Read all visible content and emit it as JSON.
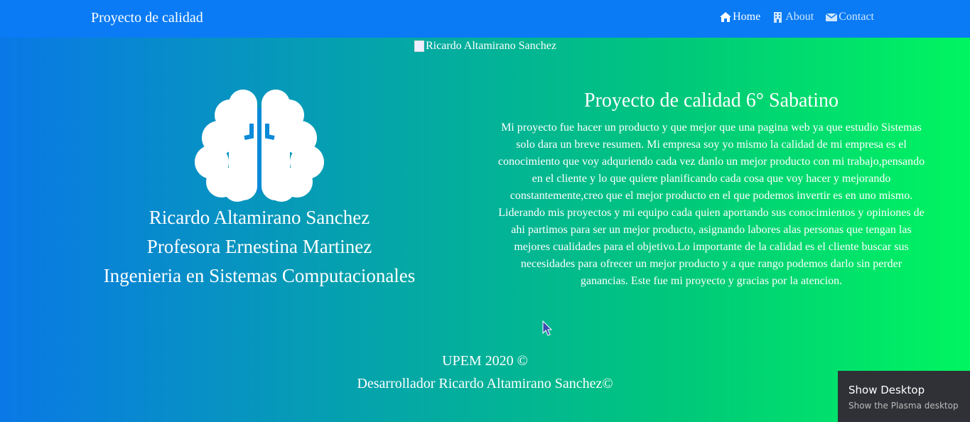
{
  "navbar": {
    "brand": "Proyecto de calidad",
    "items": [
      {
        "label": "Home",
        "icon": "home-icon",
        "active": true
      },
      {
        "label": "About",
        "icon": "building-icon",
        "active": false
      },
      {
        "label": "Contact",
        "icon": "envelope-icon",
        "active": false
      }
    ]
  },
  "banner_image": {
    "alt": "Ricardo Altamirano Sanchez"
  },
  "profile": {
    "icon": "brain-icon",
    "name": "Ricardo Altamirano Sanchez",
    "teacher": "Profesora Ernestina Martinez",
    "career": "Ingenieria en Sistemas Computacionales"
  },
  "about": {
    "title": "Proyecto de calidad 6° Sabatino",
    "body": "Mi proyecto fue hacer un producto y que mejor que una pagina web ya que estudio Sistemas solo dara un breve resumen. Mi empresa soy yo mismo la calidad de mi empresa es el conocimiento que voy adquriendo cada vez danlo un mejor producto con mi trabajo,pensando en el cliente y lo que quiere planificando cada cosa que voy hacer y mejorando constantemente,creo que el mejor producto en el que podemos invertir es en uno mismo. Liderando mis proyectos y mi equipo cada quien aportando sus conocimientos y opiniones de ahi partimos para ser un mejor producto, asignando labores alas personas que tengan las mejores cualidades para el objetivo.Lo importante de la calidad es el cliente buscar sus necesidades para ofrecer un mejor producto y a que rango podemos darlo sin perder ganancias. Este fue mi proyecto y gracias por la atencion."
  },
  "footer": {
    "line1": "UPEM 2020 ©",
    "line2": "Desarrollador Ricardo Altamirano Sanchez©"
  },
  "tooltip": {
    "title": "Show Desktop",
    "subtitle": "Show the Plasma desktop"
  },
  "colors": {
    "navbar": "#0a7bf5",
    "gradient_start": "#0a78e6",
    "gradient_end": "#00f560"
  }
}
